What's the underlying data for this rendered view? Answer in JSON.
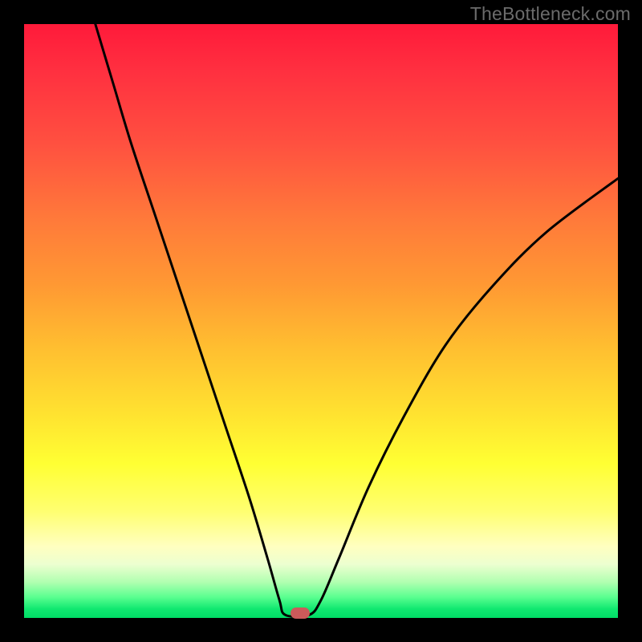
{
  "watermark": {
    "text": "TheBottleneck.com"
  },
  "colors": {
    "frame": "#000000",
    "curve": "#000000",
    "marker": "#cc5a5a",
    "gradient_stops": [
      "#ff1a3a",
      "#ff3040",
      "#ff5040",
      "#ff7a3a",
      "#ff9933",
      "#ffc030",
      "#ffe030",
      "#ffff33",
      "#ffff70",
      "#ffffc0",
      "#ecffd0",
      "#b0ffb0",
      "#5aff90",
      "#10e870",
      "#00dd66"
    ]
  },
  "chart_data": {
    "type": "line",
    "title": "",
    "xlabel": "",
    "ylabel": "",
    "xlim": [
      0,
      100
    ],
    "ylim": [
      0,
      100
    ],
    "grid": false,
    "curve_points": [
      {
        "x": 12,
        "y": 100
      },
      {
        "x": 15,
        "y": 90
      },
      {
        "x": 18,
        "y": 80
      },
      {
        "x": 22,
        "y": 68
      },
      {
        "x": 26,
        "y": 56
      },
      {
        "x": 30,
        "y": 44
      },
      {
        "x": 34,
        "y": 32
      },
      {
        "x": 38,
        "y": 20
      },
      {
        "x": 41,
        "y": 10
      },
      {
        "x": 43,
        "y": 3
      },
      {
        "x": 44,
        "y": 0.5
      },
      {
        "x": 48,
        "y": 0.5
      },
      {
        "x": 50,
        "y": 3
      },
      {
        "x": 53,
        "y": 10
      },
      {
        "x": 58,
        "y": 22
      },
      {
        "x": 64,
        "y": 34
      },
      {
        "x": 71,
        "y": 46
      },
      {
        "x": 79,
        "y": 56
      },
      {
        "x": 88,
        "y": 65
      },
      {
        "x": 100,
        "y": 74
      }
    ],
    "marker": {
      "x": 46.5,
      "y": 0.8,
      "shape": "rounded-rect"
    },
    "interpretation": "V-shaped bottleneck curve; minimum (optimal balance) near x≈46, rising steeply on both sides; background gradient encodes severity from green (low, bottom) to red (high, top)."
  }
}
